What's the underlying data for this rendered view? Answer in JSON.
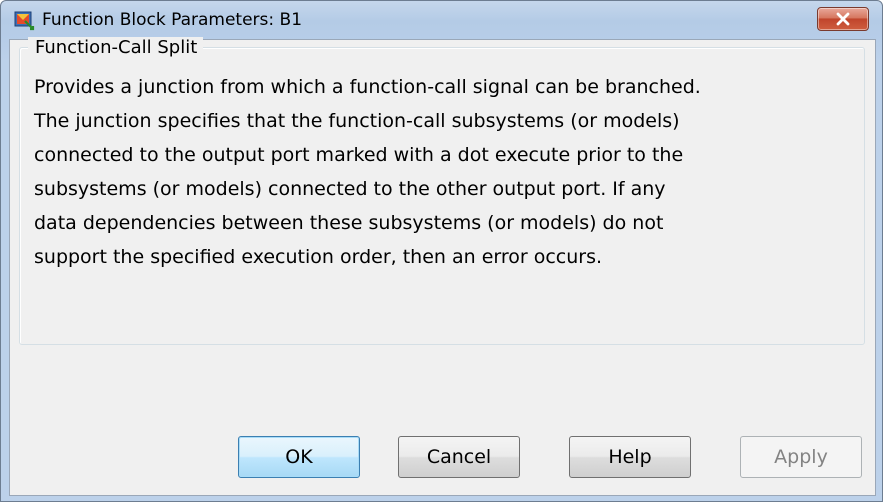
{
  "window": {
    "title": "Function Block Parameters: B1",
    "close_icon": "close-icon"
  },
  "group": {
    "legend": "Function-Call Split",
    "description_lines": [
      "Provides a junction from which a function-call signal can be branched.",
      "The junction specifies that the function-call subsystems (or models)",
      "connected to the output port marked with a dot execute prior to the",
      "subsystems (or models) connected to the other output port. If any",
      "data dependencies between these subsystems (or models) do not",
      "support the specified execution order, then an error occurs."
    ]
  },
  "buttons": {
    "ok": "OK",
    "cancel": "Cancel",
    "help": "Help",
    "apply": "Apply"
  },
  "colors": {
    "title_bar": "#b9cfe9",
    "close_button": "#c7502f",
    "default_button_border": "#3c7fb1",
    "disabled_text": "#838383"
  }
}
